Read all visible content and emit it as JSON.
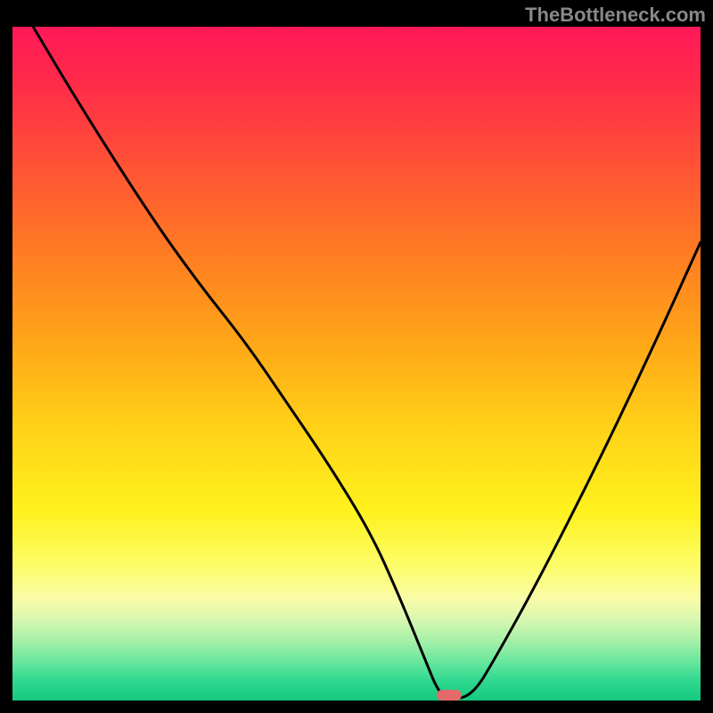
{
  "attribution": "TheBottleneck.com",
  "colors": {
    "frame": "#000000",
    "curve": "#000000",
    "marker": "#e46a6a",
    "attribution_text": "#888888",
    "gradient_stops": [
      {
        "pos": 0.0,
        "hex": "#ff1a58"
      },
      {
        "pos": 0.08,
        "hex": "#ff2a4a"
      },
      {
        "pos": 0.18,
        "hex": "#ff4a3a"
      },
      {
        "pos": 0.28,
        "hex": "#ff6a2a"
      },
      {
        "pos": 0.38,
        "hex": "#ff8a1e"
      },
      {
        "pos": 0.48,
        "hex": "#ffaa18"
      },
      {
        "pos": 0.6,
        "hex": "#ffd318"
      },
      {
        "pos": 0.72,
        "hex": "#fff21e"
      },
      {
        "pos": 0.8,
        "hex": "#fdfd6a"
      },
      {
        "pos": 0.85,
        "hex": "#f9fca8"
      },
      {
        "pos": 0.88,
        "hex": "#d8f7b0"
      },
      {
        "pos": 0.91,
        "hex": "#a8f0a8"
      },
      {
        "pos": 0.94,
        "hex": "#6de89e"
      },
      {
        "pos": 0.97,
        "hex": "#31d890"
      },
      {
        "pos": 1.0,
        "hex": "#14c97e"
      }
    ]
  },
  "chart_data": {
    "type": "line",
    "title": "",
    "xlabel": "",
    "ylabel": "",
    "xlim": [
      0,
      100
    ],
    "ylim": [
      0,
      100
    ],
    "note": "x and y are normalized 0-100; y=0 is bottom (green), y=100 is top (red). Curve is a V-shaped bottleneck profile; trough near x≈63.",
    "series": [
      {
        "name": "bottleneck-curve",
        "x": [
          3,
          10,
          20,
          27,
          34,
          40,
          46,
          52,
          56,
          60,
          62,
          64,
          67,
          70,
          76,
          84,
          92,
          100
        ],
        "y": [
          100,
          88,
          72,
          62,
          53,
          44,
          35,
          25,
          16,
          6,
          1,
          0,
          1,
          6,
          17,
          33,
          50,
          68
        ]
      }
    ],
    "marker": {
      "name": "optimal-point",
      "x_center": 63.5,
      "y": 0,
      "x_half_width": 1.8
    }
  }
}
